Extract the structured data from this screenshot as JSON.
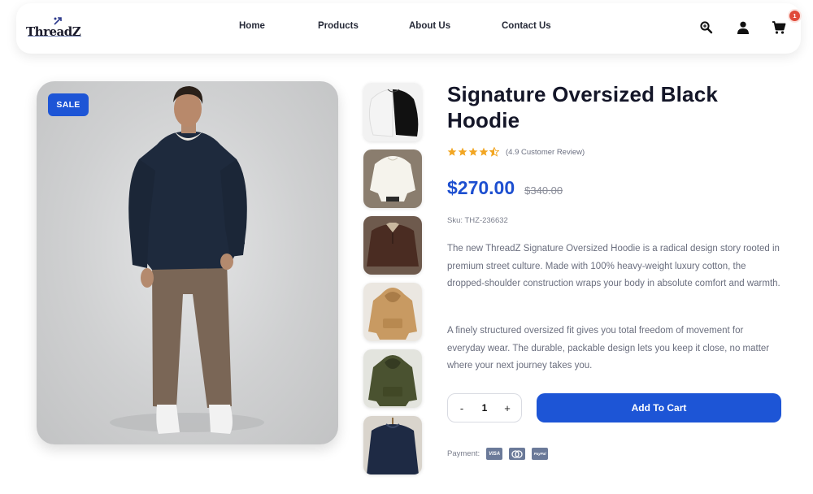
{
  "brand": {
    "name": "ThreadZ"
  },
  "nav": {
    "items": [
      {
        "label": "Home"
      },
      {
        "label": "Products"
      },
      {
        "label": "About Us"
      },
      {
        "label": "Contact Us"
      }
    ]
  },
  "header_icons": {
    "search": "search-icon",
    "account": "user-icon",
    "cart": "cart-icon",
    "cart_count": "1"
  },
  "product": {
    "badge": "SALE",
    "title": "Signature Oversized Black Hoodie",
    "rating": 4.5,
    "review_text": "(4.9 Customer Review)",
    "price": "$270.00",
    "old_price": "$340.00",
    "sku": "Sku: THZ-236632",
    "description": [
      "The new ThreadZ Signature Oversized Hoodie is a radical design story rooted in premium street culture. Made with 100% heavy-weight luxury cotton, the dropped-shoulder construction wraps your body in absolute comfort and warmth.",
      "A finely structured oversized fit gives you total freedom of movement for everyday wear. The durable, packable design lets you keep it close, no matter where your next journey takes you."
    ],
    "quantity": "1",
    "qty_minus": "-",
    "qty_plus": "+",
    "add_to_cart": "Add To Cart",
    "payment_label": "Payment:",
    "payment_methods": [
      "VISA",
      "mastercard",
      "PayPal"
    ]
  },
  "colors": {
    "accent": "#1d55d6",
    "price": "#1d4fd0",
    "star": "#f2a623",
    "badge_red": "#e04b3a"
  }
}
